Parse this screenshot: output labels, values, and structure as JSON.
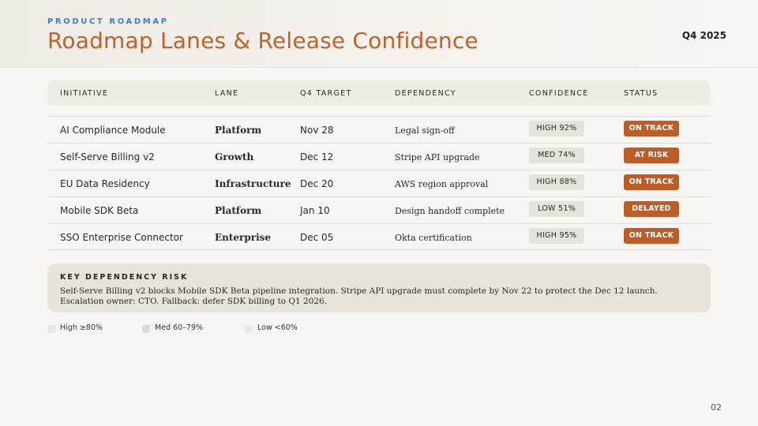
{
  "header": {
    "eyebrow": "PRODUCT ROADMAP",
    "title": "Roadmap Lanes & Release Confidence",
    "period": "Q4 2025"
  },
  "table": {
    "columns": [
      "INITIATIVE",
      "LANE",
      "Q4 TARGET",
      "DEPENDENCY",
      "CONFIDENCE",
      "STATUS"
    ],
    "rows": [
      {
        "initiative": "AI Compliance Module",
        "lane": "Platform",
        "target": "Nov 28",
        "dependency": "Legal sign-off",
        "confidence": "HIGH 92%",
        "status": "ON TRACK"
      },
      {
        "initiative": "Self-Serve Billing v2",
        "lane": "Growth",
        "target": "Dec 12",
        "dependency": "Stripe API upgrade",
        "confidence": "MED 74%",
        "status": "AT RISK"
      },
      {
        "initiative": "EU Data Residency",
        "lane": "Infrastructure",
        "target": "Dec 20",
        "dependency": "AWS region approval",
        "confidence": "HIGH 88%",
        "status": "ON TRACK"
      },
      {
        "initiative": "Mobile SDK Beta",
        "lane": "Platform",
        "target": "Jan 10",
        "dependency": "Design handoff complete",
        "confidence": "LOW 51%",
        "status": "DELAYED"
      },
      {
        "initiative": "SSO Enterprise Connector",
        "lane": "Enterprise",
        "target": "Dec 05",
        "dependency": "Okta certification",
        "confidence": "HIGH 95%",
        "status": "ON TRACK"
      }
    ]
  },
  "callout": {
    "title": "KEY DEPENDENCY RISK",
    "body": "Self-Serve Billing v2 blocks Mobile SDK Beta pipeline integration. Stripe API upgrade must complete by Nov 22 to protect the Dec 12 launch. Escalation owner: CTO. Fallback: defer SDK billing to Q1 2026."
  },
  "legend": [
    {
      "label": "High ≥80%",
      "color": "#ebe8e3"
    },
    {
      "label": "Med 60–79%",
      "color": "#dedad3"
    },
    {
      "label": "Low <60%",
      "color": "#ebe8e3"
    }
  ],
  "colors": {
    "accent": "#c0622a",
    "eyebrow": "#3b7fd0",
    "status_badge": "#bd5d25",
    "confidence_badge": "#e6e2dc"
  },
  "page_number": "02"
}
